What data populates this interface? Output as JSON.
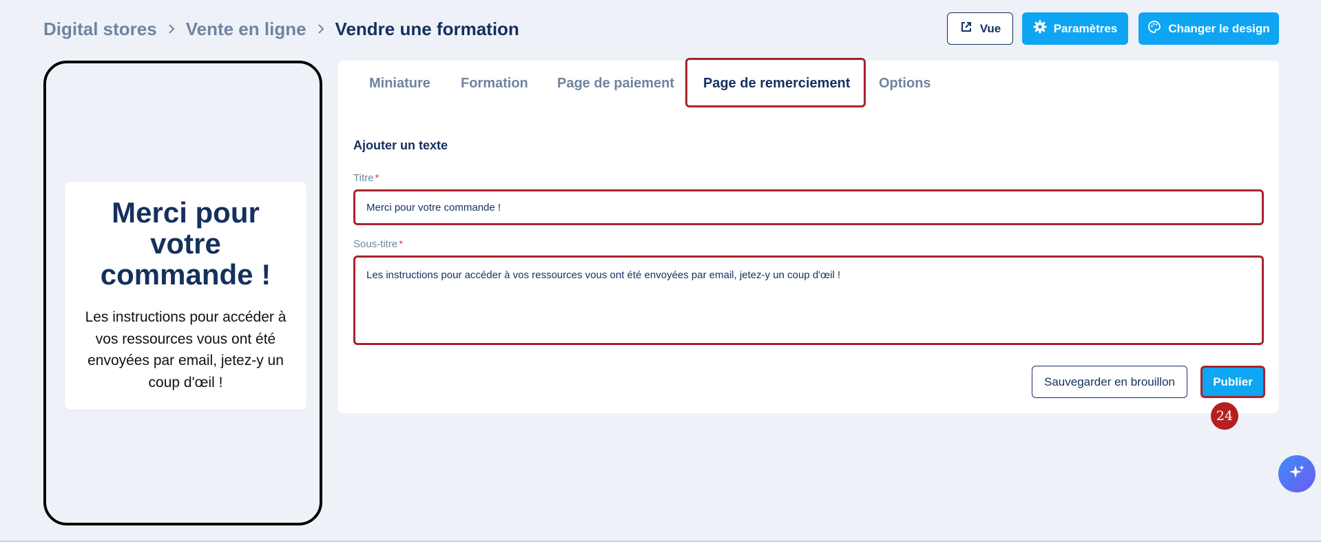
{
  "breadcrumb": {
    "items": [
      "Digital stores",
      "Vente en ligne"
    ],
    "current": "Vendre une formation"
  },
  "header": {
    "view_label": "Vue",
    "settings_label": "Paramètres",
    "design_label": "Changer le design"
  },
  "preview": {
    "title": "Merci pour votre commande !",
    "subtitle": "Les instructions pour accéder à vos ressources vous ont été envoyées par email, jetez-y un coup d'œil !"
  },
  "tabs": [
    {
      "label": "Miniature",
      "active": false
    },
    {
      "label": "Formation",
      "active": false
    },
    {
      "label": "Page de paiement",
      "active": false
    },
    {
      "label": "Page de remerciement",
      "active": true
    },
    {
      "label": "Options",
      "active": false
    }
  ],
  "form": {
    "section_title": "Ajouter un texte",
    "title_label": "Titre",
    "title_value": "Merci pour votre commande !",
    "subtitle_label": "Sous-titre",
    "subtitle_value": "Les instructions pour accéder à vos ressources vous ont été envoyées par email, jetez-y un coup d'œil !",
    "required_mark": "*"
  },
  "actions": {
    "draft_label": "Sauvegarder en brouillon",
    "publish_label": "Publier"
  },
  "step_badge": "24",
  "colors": {
    "accent": "#0ea5f2",
    "navy": "#14305e",
    "highlight": "#a8232b",
    "badge": "#b3201f"
  },
  "icons": {
    "view": "external-link-icon",
    "settings": "gear-icon",
    "design": "palette-icon",
    "separator": "chevron-right-icon",
    "ai": "sparkle-icon"
  }
}
